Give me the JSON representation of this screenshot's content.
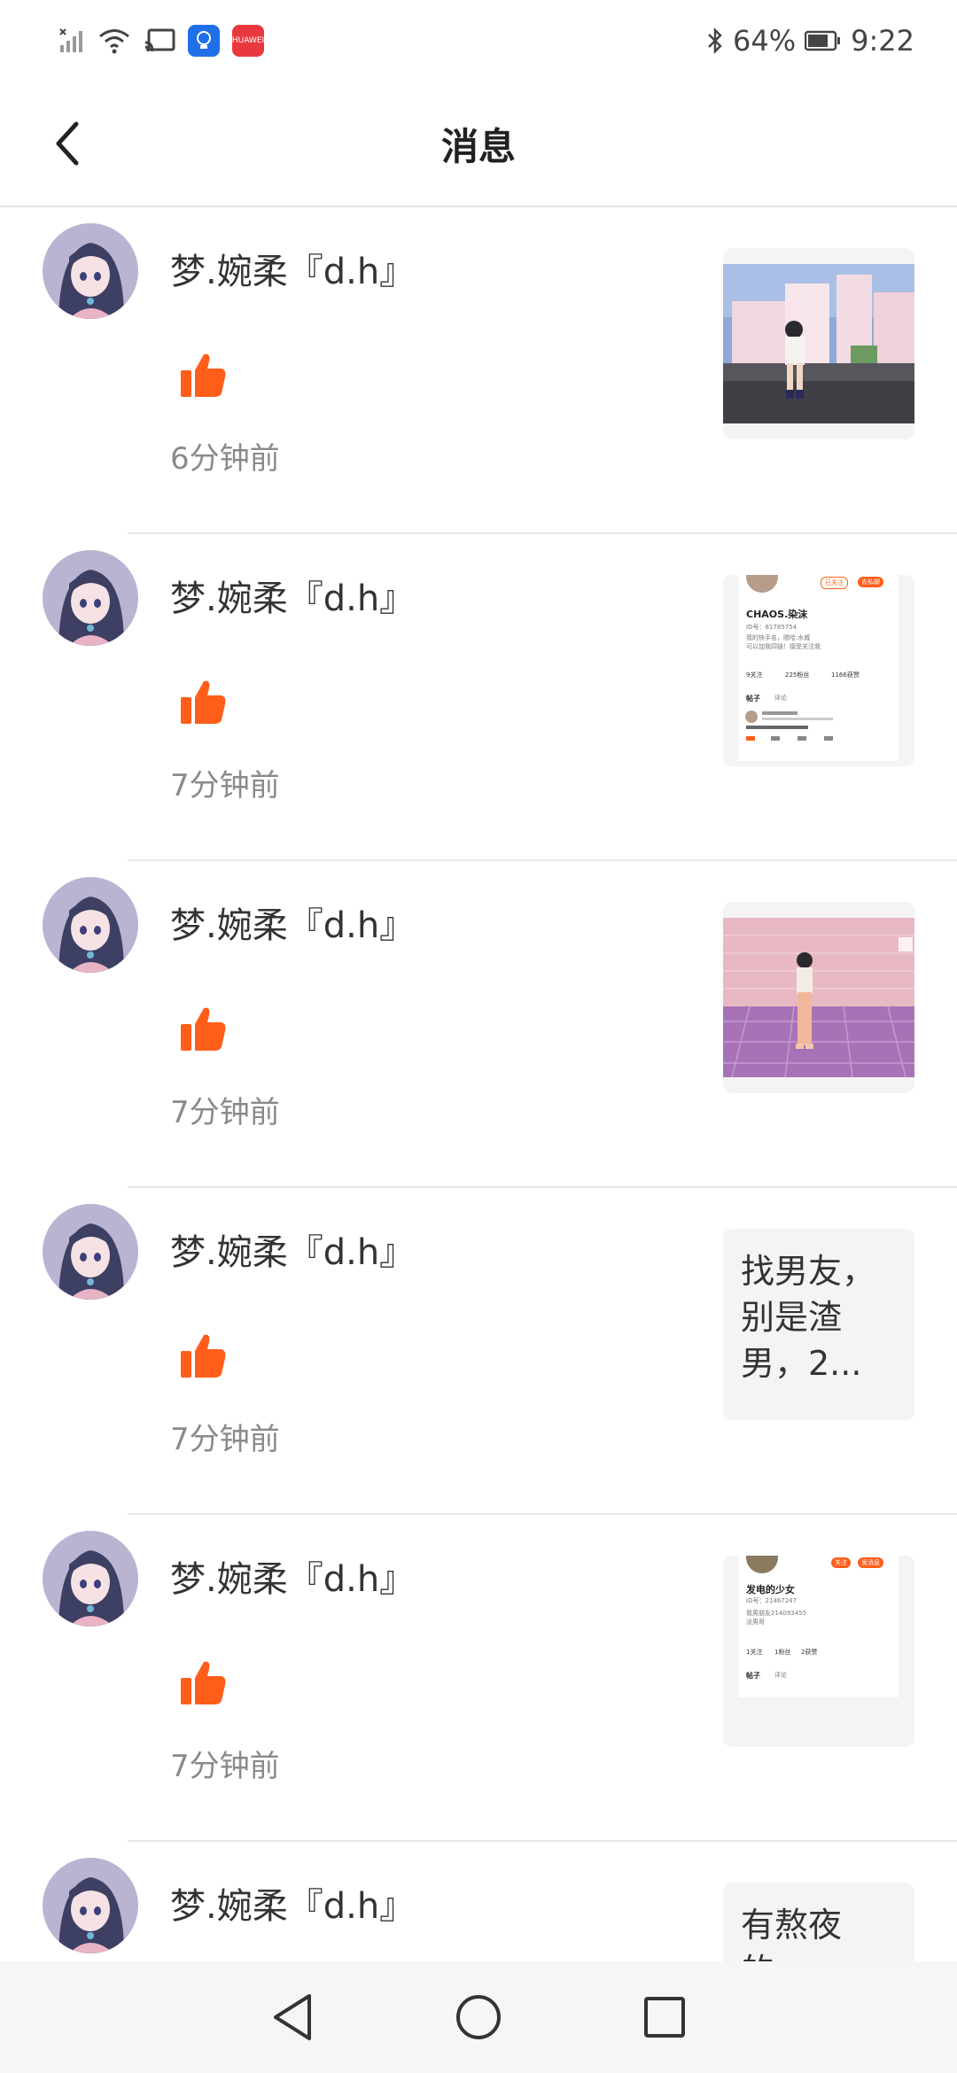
{
  "status_bar": {
    "battery_percent": "64%",
    "time": "9:22",
    "app_badge_label": "HUAWEI"
  },
  "header": {
    "title": "消息"
  },
  "messages": [
    {
      "username": "梦.婉柔『d.h』",
      "time": "6分钟前",
      "thumbnail": {
        "kind": "image",
        "icon": "game-scene-thumbnail"
      }
    },
    {
      "username": "梦.婉柔『d.h』",
      "time": "7分钟前",
      "thumbnail": {
        "kind": "profile-card",
        "name": "CHAOS.染沫",
        "id": "ID号：81785754",
        "bio1": "我的快手名，嗯哈.水威",
        "bio2": "可以加我四链！接受关注我",
        "stat1": "9关注",
        "stat2": "225粉丝",
        "stat3": "1166获赞",
        "tab1": "帖子",
        "tab2": "评论",
        "follow": "已关注",
        "chat": "去私聊"
      }
    },
    {
      "username": "梦.婉柔『d.h』",
      "time": "7分钟前",
      "thumbnail": {
        "kind": "image",
        "icon": "character-thumbnail"
      }
    },
    {
      "username": "梦.婉柔『d.h』",
      "time": "7分钟前",
      "thumbnail": {
        "kind": "text",
        "text": "找男友，别是渣男，2..."
      }
    },
    {
      "username": "梦.婉柔『d.h』",
      "time": "7分钟前",
      "thumbnail": {
        "kind": "profile-card",
        "name": "发电的少女",
        "id": "ID号：21467247",
        "bio1": "我男朋友214093455",
        "bio2": "没男哥",
        "stat1": "1关注",
        "stat2": "1粉丝",
        "stat3": "2获赞",
        "tab1": "帖子",
        "tab2": "评论",
        "follow": "关注",
        "chat": "发消息"
      }
    },
    {
      "username": "梦.婉柔『d.h』",
      "time": "",
      "thumbnail": {
        "kind": "text",
        "text": "有熬夜的..."
      }
    }
  ],
  "colors": {
    "accent": "#ff5e1a",
    "divider": "#e8e8e8",
    "muted_text": "#8a8a8a"
  }
}
